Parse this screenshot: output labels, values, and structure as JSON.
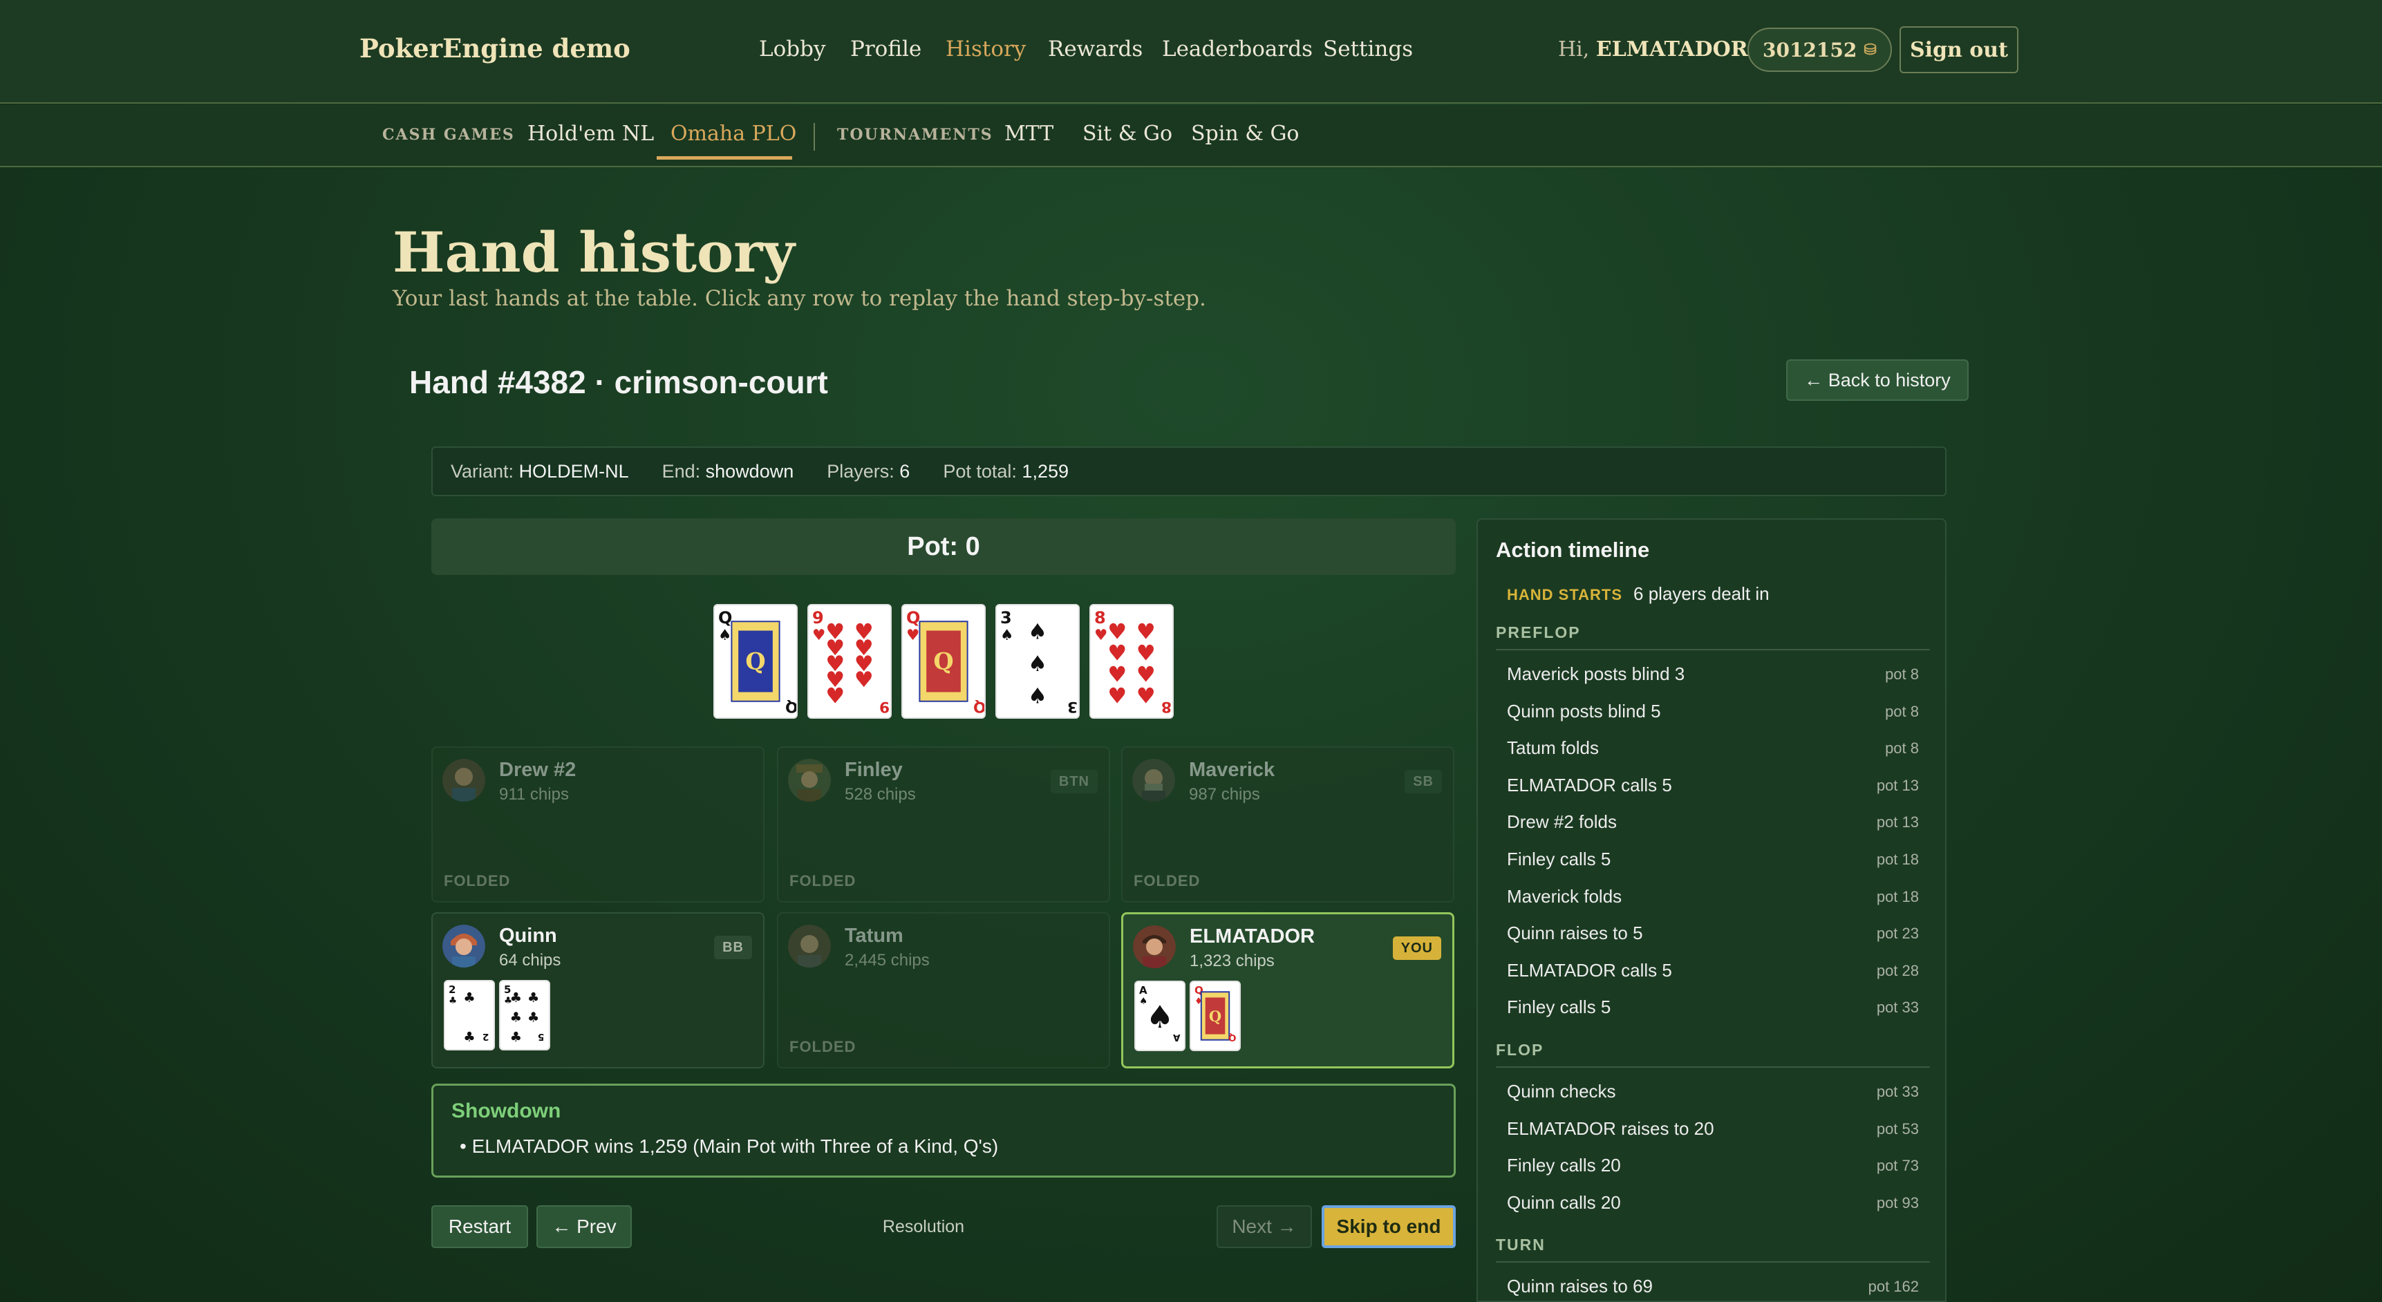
{
  "nav": {
    "brand": "PokerEngine demo",
    "links": [
      "Lobby",
      "Profile",
      "History",
      "Rewards",
      "Leaderboards",
      "Settings"
    ],
    "active": "History",
    "greeting": "Hi,",
    "username": "ELMATADOR",
    "chips": "3012152",
    "chip_icon": "⛁",
    "signout": "Sign out"
  },
  "subnav": {
    "cash_label": "CASH GAMES",
    "cash_links": [
      "Hold'em NL",
      "Omaha PLO"
    ],
    "active": "Omaha PLO",
    "tourn_label": "TOURNAMENTS",
    "tourn_links": [
      "MTT",
      "Sit & Go",
      "Spin & Go"
    ]
  },
  "page": {
    "title": "Hand history",
    "subtitle": "Your last hands at the table. Click any row to replay the hand step-by-step."
  },
  "hand": {
    "title": "Hand #4382 · crimson-court",
    "back": "← Back to history",
    "info": [
      {
        "k": "Variant:",
        "v": "HOLDEM-NL"
      },
      {
        "k": "End:",
        "v": "showdown"
      },
      {
        "k": "Players:",
        "v": "6"
      },
      {
        "k": "Pot total:",
        "v": "1,259"
      }
    ],
    "pot": "Pot: 0",
    "board": [
      "Q♠",
      "9♥",
      "Q♥",
      "3♠",
      "8♥"
    ]
  },
  "seats": [
    {
      "name": "Drew #2",
      "chips": "911 chips",
      "badge": "",
      "folded": "FOLDED",
      "cards": []
    },
    {
      "name": "Finley",
      "chips": "528 chips",
      "badge": "BTN",
      "folded": "FOLDED",
      "cards": []
    },
    {
      "name": "Maverick",
      "chips": "987 chips",
      "badge": "SB",
      "folded": "FOLDED",
      "cards": []
    },
    {
      "name": "Quinn",
      "chips": "64 chips",
      "badge": "BB",
      "folded": "",
      "cards": [
        "2♣",
        "5♣"
      ]
    },
    {
      "name": "Tatum",
      "chips": "2,445 chips",
      "badge": "",
      "folded": "FOLDED",
      "cards": []
    },
    {
      "name": "ELMATADOR",
      "chips": "1,323 chips",
      "badge": "YOU",
      "folded": "",
      "cards": [
        "A♠",
        "Q♦"
      ]
    }
  ],
  "showdown": {
    "title": "Showdown",
    "line": "ELMATADOR wins 1,259 (Main Pot with Three of a Kind, Q's)"
  },
  "controls": {
    "restart": "Restart",
    "prev": "← Prev",
    "status": "Resolution",
    "next": "Next →",
    "skip": "Skip to end"
  },
  "timeline": {
    "title": "Action timeline",
    "start_tag": "HAND STARTS",
    "start_text": "6 players dealt in",
    "phases": [
      {
        "name": "PREFLOP",
        "rows": [
          {
            "t": "Maverick posts blind 3",
            "pot": "pot 8"
          },
          {
            "t": "Quinn posts blind 5",
            "pot": "pot 8"
          },
          {
            "t": "Tatum folds",
            "pot": "pot 8"
          },
          {
            "t": "ELMATADOR calls 5",
            "pot": "pot 13"
          },
          {
            "t": "Drew #2 folds",
            "pot": "pot 13"
          },
          {
            "t": "Finley calls 5",
            "pot": "pot 18"
          },
          {
            "t": "Maverick folds",
            "pot": "pot 18"
          },
          {
            "t": "Quinn raises to 5",
            "pot": "pot 23"
          },
          {
            "t": "ELMATADOR calls 5",
            "pot": "pot 28"
          },
          {
            "t": "Finley calls 5",
            "pot": "pot 33"
          }
        ]
      },
      {
        "name": "FLOP",
        "rows": [
          {
            "t": "Quinn checks",
            "pot": "pot 33"
          },
          {
            "t": "ELMATADOR raises to 20",
            "pot": "pot 53"
          },
          {
            "t": "Finley calls 20",
            "pot": "pot 73"
          },
          {
            "t": "Quinn calls 20",
            "pot": "pot 93"
          }
        ]
      },
      {
        "name": "TURN",
        "rows": [
          {
            "t": "Quinn raises to 69",
            "pot": "pot 162"
          }
        ]
      }
    ]
  }
}
